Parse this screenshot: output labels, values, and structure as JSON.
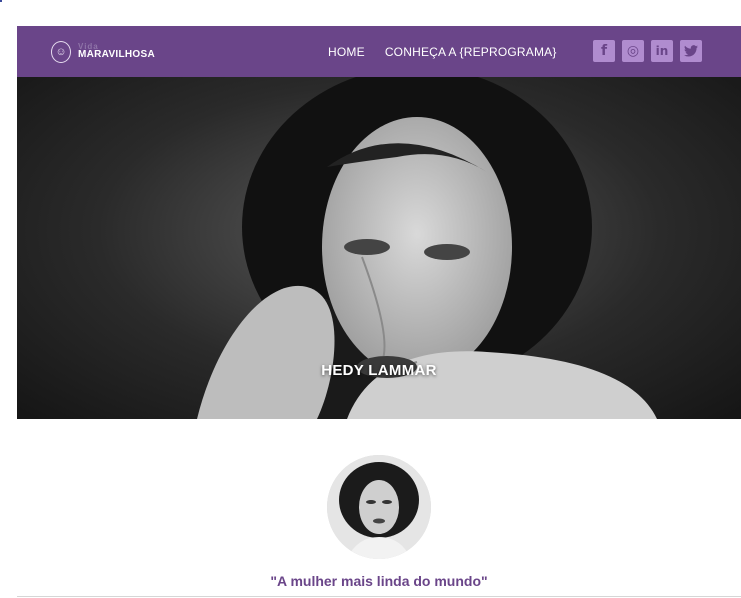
{
  "brand": {
    "small": "Vida",
    "main": "MARAVILHOSA",
    "icon": "face-logo-icon"
  },
  "nav": {
    "items": [
      {
        "label": "HOME"
      },
      {
        "label": "CONHEÇA A {REPROGRAMA}"
      }
    ]
  },
  "social": [
    {
      "icon": "facebook-icon",
      "glyph": "f"
    },
    {
      "icon": "instagram-icon",
      "glyph": "◎"
    },
    {
      "icon": "linkedin-icon",
      "glyph": "in"
    },
    {
      "icon": "twitter-icon",
      "glyph": "🐦"
    }
  ],
  "hero": {
    "name": "HEDY LAMMAR"
  },
  "profile": {
    "quote": "\"A mulher mais linda do mundo\""
  },
  "colors": {
    "nav_bg": "#6a4589",
    "social_icon": "#b08ccf",
    "quote": "#6a4589"
  }
}
